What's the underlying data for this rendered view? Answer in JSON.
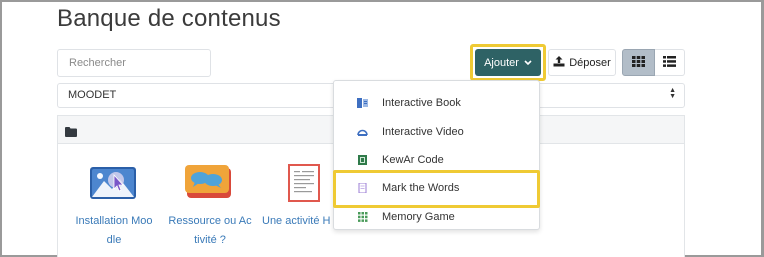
{
  "page": {
    "title": "Banque de contenus"
  },
  "toolbar": {
    "search_placeholder": "Rechercher",
    "add_label": "Ajouter",
    "upload_label": "Déposer",
    "grid_view_icon": "grid-view-icon",
    "list_view_icon": "list-view-icon"
  },
  "context_selector": {
    "value": "MOODET"
  },
  "folder": {
    "icon": "folder-icon"
  },
  "content_items": [
    {
      "label_line1": "Installation Moo",
      "label_line2": "dle",
      "icon": "interactive-book-thumbnail"
    },
    {
      "label_line1": "Ressource ou Ac",
      "label_line2": "tivité ?",
      "icon": "chat-bubbles-thumbnail"
    },
    {
      "label_line1": "Une activité H",
      "label_line2": "",
      "icon": "document-thumbnail"
    }
  ],
  "add_menu": {
    "items": [
      {
        "label": "Interactive Book",
        "icon": "interactive-book-icon"
      },
      {
        "label": "Interactive Video",
        "icon": "interactive-video-icon"
      },
      {
        "label": "KewAr Code",
        "icon": "qr-code-icon"
      },
      {
        "label": "Mark the Words",
        "icon": "mark-the-words-icon"
      },
      {
        "label": "Memory Game",
        "icon": "memory-game-icon"
      }
    ]
  },
  "colors": {
    "accent_button": "#2e6265",
    "highlight": "#efca34",
    "link": "#3a7ab8"
  }
}
